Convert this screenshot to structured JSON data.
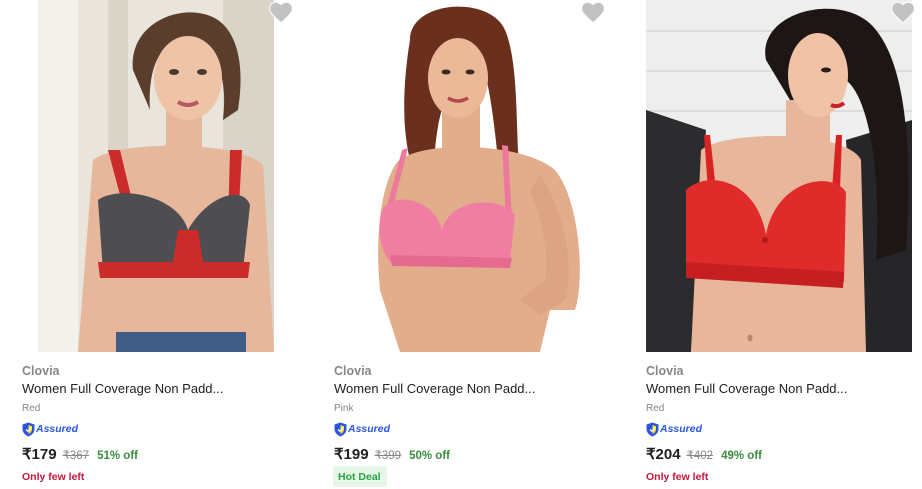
{
  "products": [
    {
      "brand": "Clovia",
      "title": "Women Full Coverage Non Padd...",
      "variant": "Red",
      "assured_label": "Assured",
      "price": "₹179",
      "mrp": "₹367",
      "discount": "51% off",
      "availability": "Only few left",
      "badge": "",
      "image_icon": "product-photo",
      "wishlist_icon": "heart-icon"
    },
    {
      "brand": "Clovia",
      "title": "Women Full Coverage Non Padd...",
      "variant": "Pink",
      "assured_label": "Assured",
      "price": "₹199",
      "mrp": "₹399",
      "discount": "50% off",
      "availability": "",
      "badge": "Hot Deal",
      "image_icon": "product-photo",
      "wishlist_icon": "heart-icon"
    },
    {
      "brand": "Clovia",
      "title": "Women Full Coverage Non Padd...",
      "variant": "Red",
      "assured_label": "Assured",
      "price": "₹204",
      "mrp": "₹402",
      "discount": "49% off",
      "availability": "Only few left",
      "badge": "",
      "image_icon": "product-photo",
      "wishlist_icon": "heart-icon"
    }
  ],
  "colors": {
    "discount": "#388e3c",
    "availability": "#c4183c",
    "assured": "#2a55e5",
    "hot_deal_bg": "#e6f6e8",
    "hot_deal_text": "#26a541",
    "wishlist": "#c2c2c2"
  }
}
